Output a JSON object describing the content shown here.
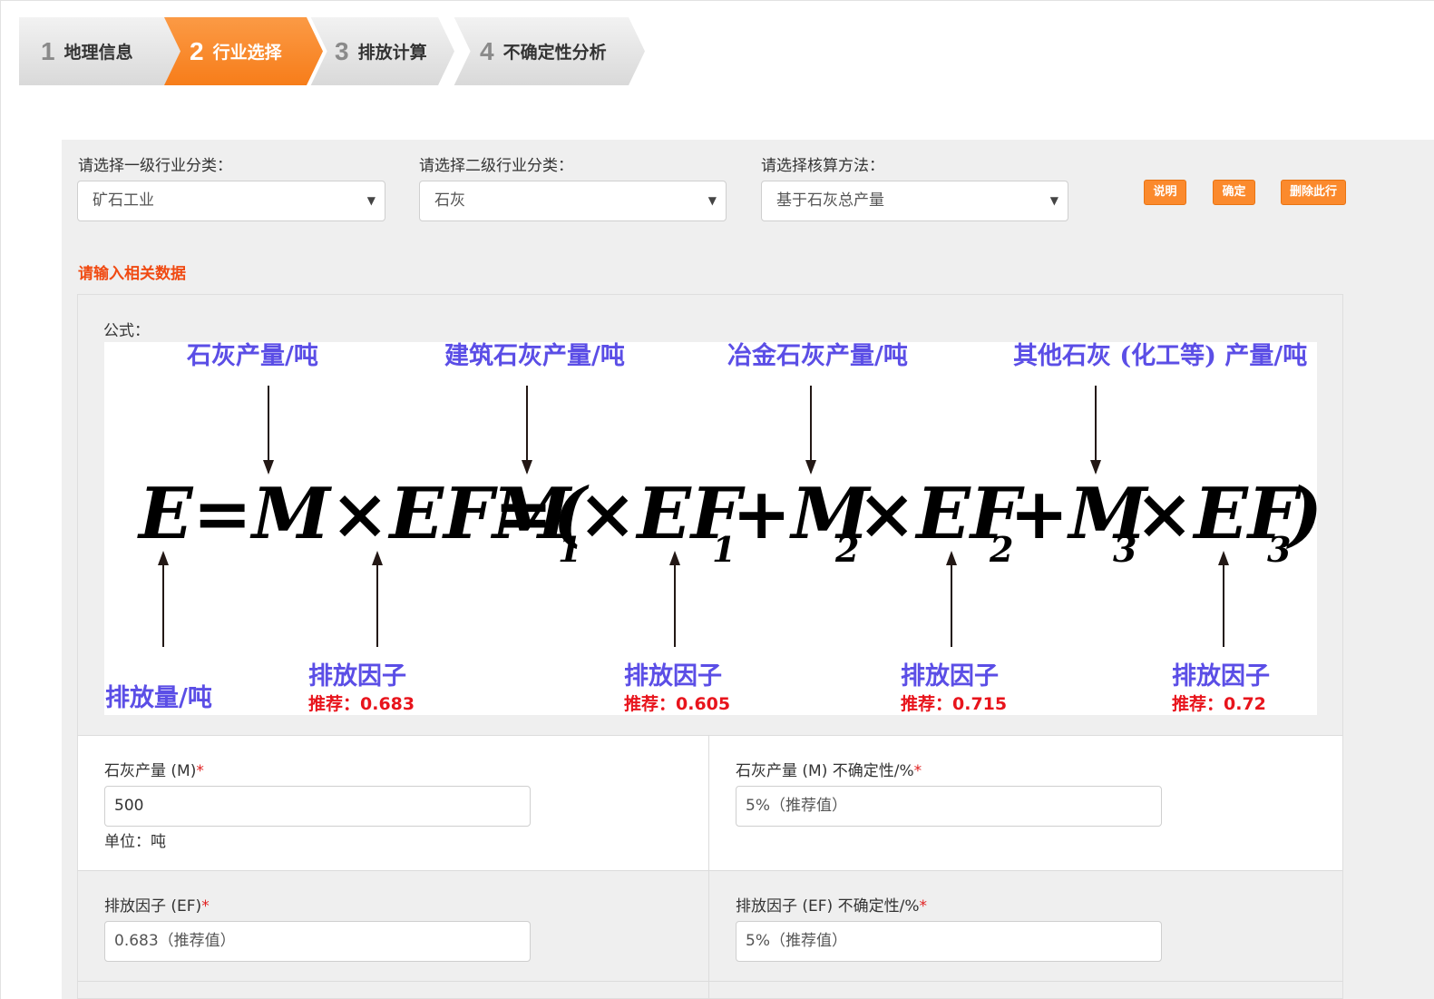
{
  "wizard": {
    "steps": [
      {
        "num": "1",
        "label": "地理信息",
        "state": "done"
      },
      {
        "num": "2",
        "label": "行业选择",
        "state": "active"
      },
      {
        "num": "3",
        "label": "排放计算",
        "state": "todo"
      },
      {
        "num": "4",
        "label": "不确定性分析",
        "state": "todo"
      }
    ]
  },
  "selectors": {
    "level1": {
      "label": "请选择一级行业分类：",
      "value": "矿石工业"
    },
    "level2": {
      "label": "请选择二级行业分类：",
      "value": "石灰"
    },
    "method": {
      "label": "请选择核算方法：",
      "value": "基于石灰总产量"
    }
  },
  "buttons": {
    "explain": "说明",
    "confirm": "确定",
    "delete_row": "删除此行"
  },
  "section_hint": "请输入相关数据",
  "formula": {
    "label": "公式：",
    "top_labels": [
      "石灰产量/吨",
      "建筑石灰产量/吨",
      "冶金石灰产量/吨",
      "其他石灰 (化工等) 产量/吨"
    ],
    "equation": {
      "lhs": "E=M×EF=(",
      "m1": "M",
      "s1": "1",
      "x1": "×EF",
      "e1": "1",
      "plus1": "+M",
      "s2": "2",
      "x2": "×EF",
      "e2": "2",
      "plus2": "+M",
      "s3": "3",
      "x3": "×EF",
      "e3": "3",
      "close": ")"
    },
    "bottom_labels": {
      "emission": "排放量/吨",
      "factor": "排放因子",
      "rec_prefix": "推荐：",
      "recommended": [
        "0.683",
        "0.605",
        "0.715",
        "0.72"
      ]
    },
    "colors": {
      "label_blue": "#5b4ee6",
      "rec_red": "#e8141c"
    }
  },
  "fields": {
    "production": {
      "label": "石灰产量 (M)",
      "value": "500",
      "unit": "单位：吨"
    },
    "production_uncertainty": {
      "label": "石灰产量 (M) 不确定性/%",
      "placeholder": "5%（推荐值）"
    },
    "ef": {
      "label": "排放因子 (EF)",
      "placeholder": "0.683（推荐值）"
    },
    "ef_uncertainty": {
      "label": "排放因子 (EF) 不确定性/%",
      "placeholder": "5%（推荐值）"
    },
    "required_mark": "*"
  },
  "colors": {
    "accent": "#fb8a2d",
    "hint": "#f04a12"
  }
}
